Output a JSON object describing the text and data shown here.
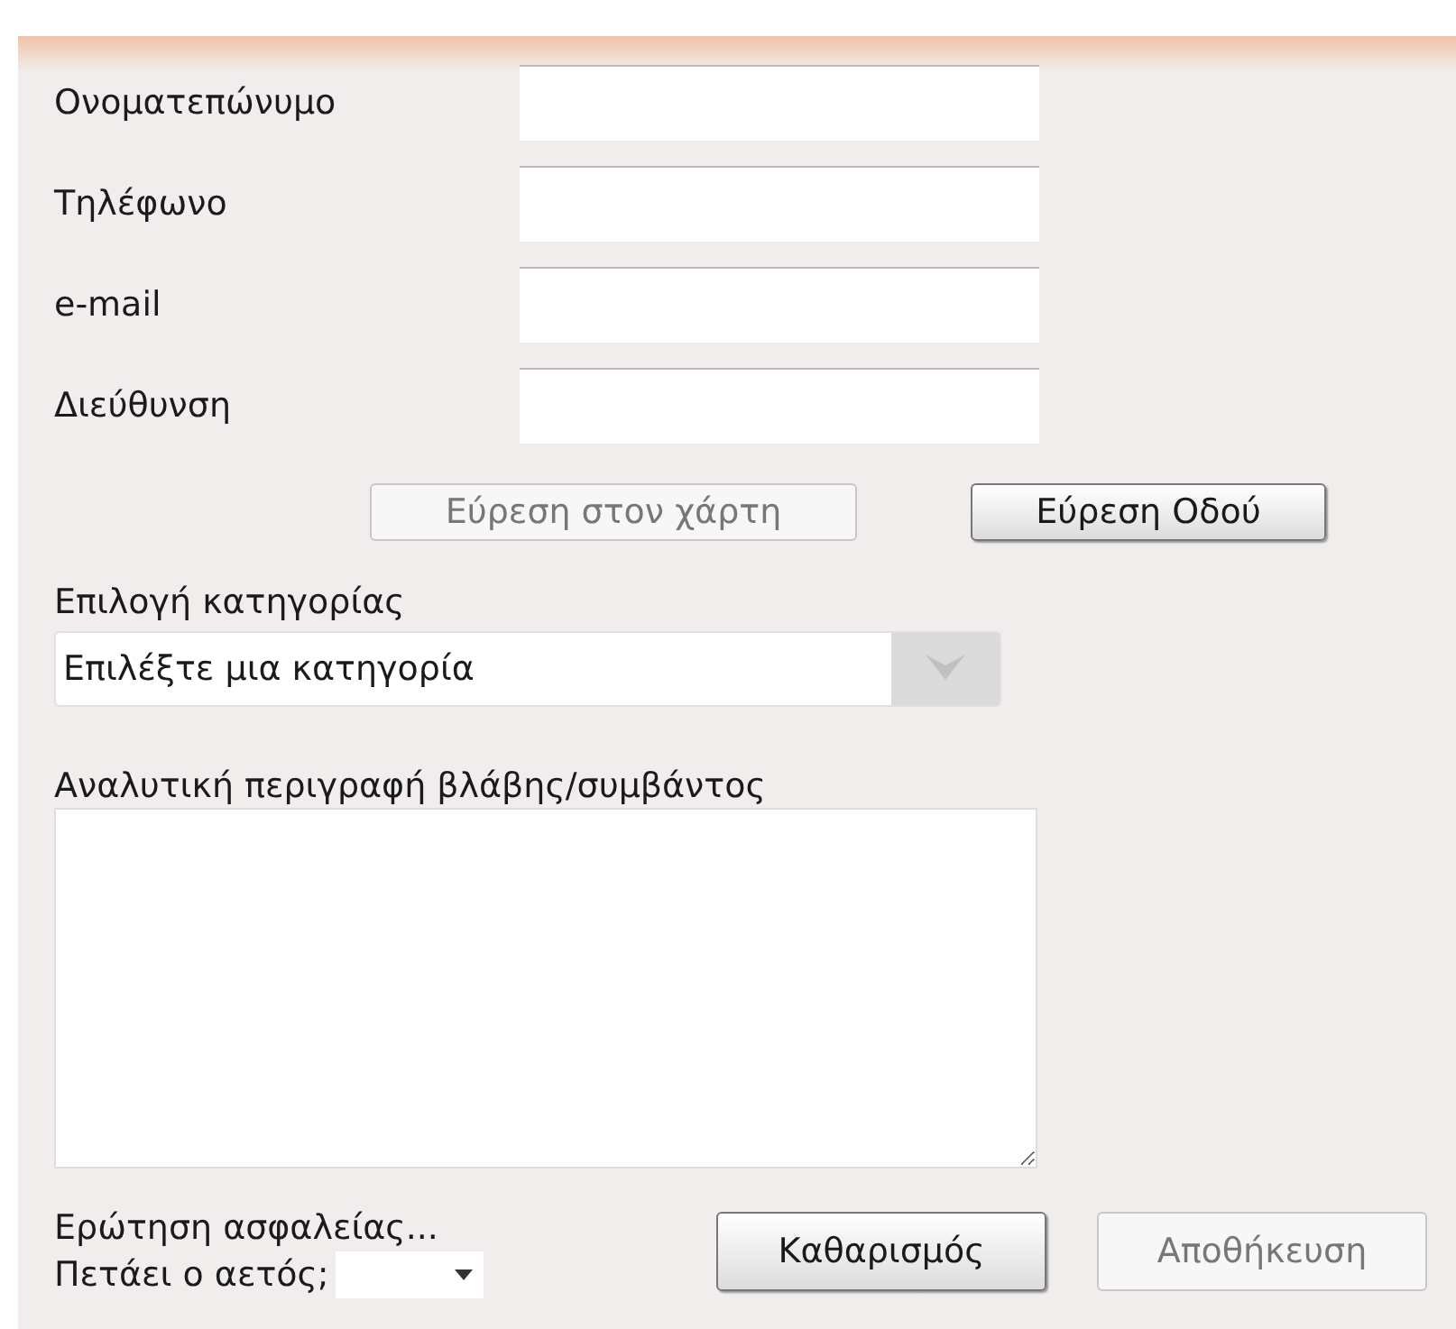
{
  "fields": [
    {
      "label": "Ονοματεπώνυμο"
    },
    {
      "label": "Τηλέφωνο"
    },
    {
      "label": "e-mail"
    },
    {
      "label": "Διεύθυνση"
    }
  ],
  "map_buttons": [
    {
      "label": "Εύρεση στον χάρτη",
      "disabled": true
    },
    {
      "label": "Εύρεση Οδού",
      "disabled": false
    }
  ],
  "category": {
    "label": "Επιλογή κατηγορίας",
    "value": "Επιλέξτε μια κατηγορία"
  },
  "description": {
    "label": "Αναλυτική περιγραφή βλάβης/συμβάντος"
  },
  "security": {
    "title": "Ερώτηση ασφαλείας...",
    "question": "Πετάει ο αετός;"
  },
  "buttons": [
    {
      "label": "Καθαρισμός",
      "disabled": false
    },
    {
      "label": "Αποθήκευση",
      "disabled": true
    }
  ]
}
